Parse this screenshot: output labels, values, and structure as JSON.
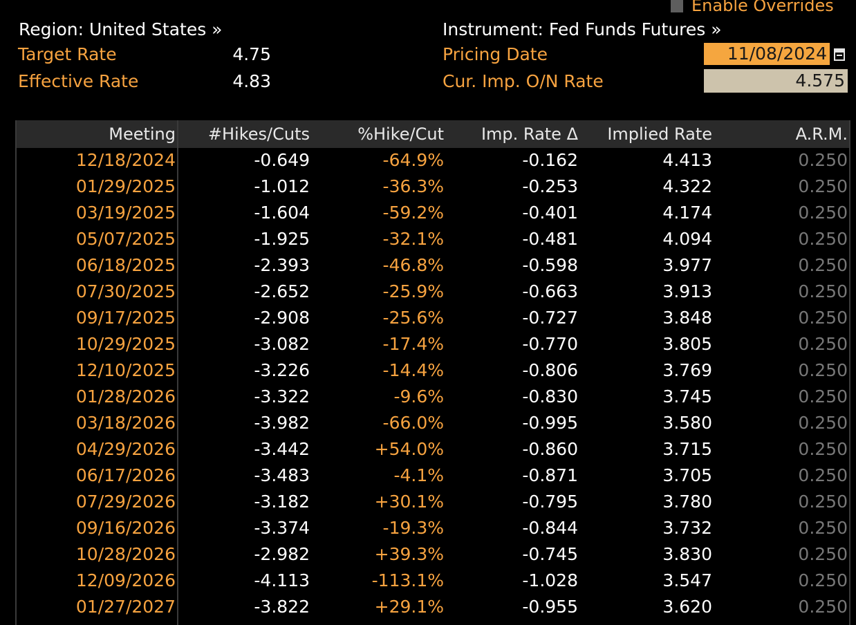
{
  "header": {
    "enable_overrides_label": "Enable Overrides",
    "region_text": "Region: United States »",
    "instrument_text": "Instrument: Fed Funds Futures »",
    "target_rate_label": "Target Rate",
    "target_rate_value": "4.75",
    "effective_rate_label": "Effective Rate",
    "effective_rate_value": "4.83",
    "pricing_date_label": "Pricing Date",
    "pricing_date_value": "11/08/2024",
    "cur_imp_on_rate_label": "Cur. Imp. O/N Rate",
    "cur_imp_on_rate_value": "4.575"
  },
  "table": {
    "columns": [
      "Meeting",
      "#Hikes/Cuts",
      "%Hike/Cut",
      "Imp. Rate Δ",
      "Implied Rate",
      "A.R.M."
    ],
    "rows": [
      [
        "12/18/2024",
        "-0.649",
        "-64.9%",
        "-0.162",
        "4.413",
        "0.250"
      ],
      [
        "01/29/2025",
        "-1.012",
        "-36.3%",
        "-0.253",
        "4.322",
        "0.250"
      ],
      [
        "03/19/2025",
        "-1.604",
        "-59.2%",
        "-0.401",
        "4.174",
        "0.250"
      ],
      [
        "05/07/2025",
        "-1.925",
        "-32.1%",
        "-0.481",
        "4.094",
        "0.250"
      ],
      [
        "06/18/2025",
        "-2.393",
        "-46.8%",
        "-0.598",
        "3.977",
        "0.250"
      ],
      [
        "07/30/2025",
        "-2.652",
        "-25.9%",
        "-0.663",
        "3.913",
        "0.250"
      ],
      [
        "09/17/2025",
        "-2.908",
        "-25.6%",
        "-0.727",
        "3.848",
        "0.250"
      ],
      [
        "10/29/2025",
        "-3.082",
        "-17.4%",
        "-0.770",
        "3.805",
        "0.250"
      ],
      [
        "12/10/2025",
        "-3.226",
        "-14.4%",
        "-0.806",
        "3.769",
        "0.250"
      ],
      [
        "01/28/2026",
        "-3.322",
        "-9.6%",
        "-0.830",
        "3.745",
        "0.250"
      ],
      [
        "03/18/2026",
        "-3.982",
        "-66.0%",
        "-0.995",
        "3.580",
        "0.250"
      ],
      [
        "04/29/2026",
        "-3.442",
        "+54.0%",
        "-0.860",
        "3.715",
        "0.250"
      ],
      [
        "06/17/2026",
        "-3.483",
        "-4.1%",
        "-0.871",
        "3.705",
        "0.250"
      ],
      [
        "07/29/2026",
        "-3.182",
        "+30.1%",
        "-0.795",
        "3.780",
        "0.250"
      ],
      [
        "09/16/2026",
        "-3.374",
        "-19.3%",
        "-0.844",
        "3.732",
        "0.250"
      ],
      [
        "10/28/2026",
        "-2.982",
        "+39.3%",
        "-0.745",
        "3.830",
        "0.250"
      ],
      [
        "12/09/2026",
        "-4.113",
        "-113.1%",
        "-1.028",
        "3.547",
        "0.250"
      ],
      [
        "01/27/2027",
        "-3.822",
        "+29.1%",
        "-0.955",
        "3.620",
        "0.250"
      ]
    ]
  },
  "colors": {
    "label_orange": "#f7a340",
    "value_white": "#ffffff",
    "arm_grey": "#777777",
    "date_field_bg": "#f5a63f",
    "rate_field_bg": "#cdc3ac",
    "header_bg": "#2a2a2a"
  }
}
